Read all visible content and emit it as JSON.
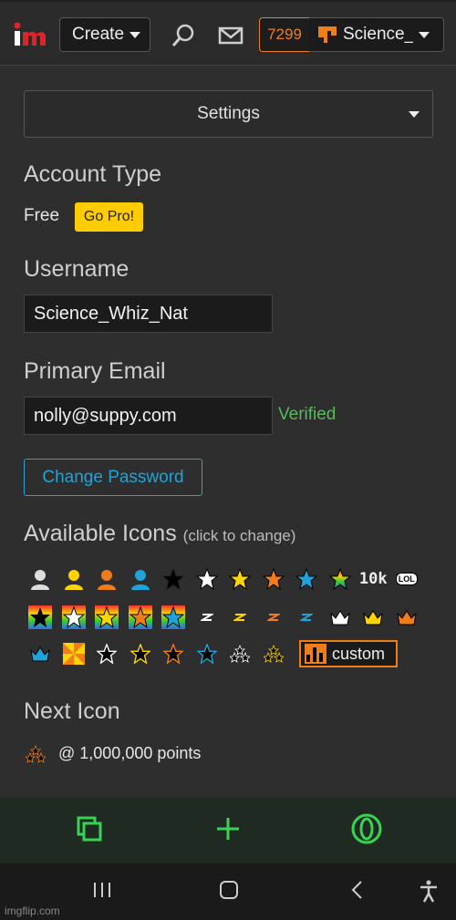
{
  "header": {
    "create_label": "Create",
    "points": "7299",
    "username_short": "Science_"
  },
  "settings_select": {
    "label": "Settings"
  },
  "account_type": {
    "title": "Account Type",
    "plan": "Free",
    "upgrade_label": "Go Pro!"
  },
  "username": {
    "title": "Username",
    "value": "Science_Whiz_Nat"
  },
  "email": {
    "title": "Primary Email",
    "value": "nolly@suppy.com",
    "status": "Verified"
  },
  "change_password_label": "Change Password",
  "available_icons": {
    "title": "Available Icons",
    "hint": "(click to change)",
    "text_icons": {
      "tenk": "10k",
      "lol": "LOL"
    },
    "custom_label": "custom"
  },
  "next_icon": {
    "title": "Next Icon",
    "requirement": "@ 1,000,000 points"
  },
  "watermark": "imgflip.com",
  "colors": {
    "accent": "#f07d1a",
    "link": "#1ea4d8",
    "success": "#5cb85c",
    "gopro": "#ffcc00",
    "toolbar_green": "#39d353"
  }
}
